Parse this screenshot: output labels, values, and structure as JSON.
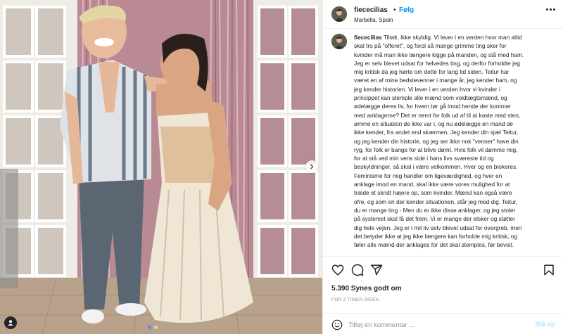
{
  "post": {
    "username": "fiececilias",
    "separator": "•",
    "follow_label": "Følg",
    "location": "Marbella, Spain",
    "caption_user": "fiececilias",
    "caption_text": "Tiltalt. Ikke skyldig. Vi lever i en verden hvor man altid\nskal tro på \"offeret\", og fordi så mange grimme ting sker for\nkvinder må man ikke længere kigge på manden, og stå med ham.\nJeg er selv blevet udsat for helvedes ting, og derfor forholdte jeg\nmig kritisk da jeg hørte om dette for lang tid siden. Teitur har\nværet en af mine bedstevenner i mange år, jeg kender ham, og\njeg kender historien. Vi lever i en verden hvor vi kvinder i\nprincippet kan stemple alle mænd som voldtægtsmænd, og\nødelægge deres liv, for hvem tør gå imod hende der kommer\nmed anklagerne? Det er nemt for folk ud af til at kaste med sten,\nømme en situation de ikke var i, og nu ødelægge en mand de\nikke kender, fra andet end skærmen. Jeg kender din sjæl Teitur,\nog jeg kender din historie, og jeg ser ikke nok \"venner\" have din\nryg, for folk er bange for at blive dømt. Hvis folk vil dømme mig,\nfor at stå ved min vens side i hans livs sværeste tid og\nbeskyldninger, så skal i være velkommen. Hver og en blokeres.\nFeminisme for mig handler om ligeværdighed, og hver en\nanklage imod en mand, skal ikke være vores mulighed for at\ntræde et skridt højere op, som kvinder. Mænd kan også være\nofre, og som en der kender situationen, står jeg med dig. Teitur,\ndu er mange ting - Men du er ikke disse anklager, og jeg stoler\npå systemet skal få det frem. Vi er mange der elsker og støtter\ndig hele vejen. Jeg er i mit liv selv blevet udsat for overgreb, men\ndet betyder ikke at jeg ikke længere kan forholde mig kritisk, og\nføler alle mænd der anklages for det skal stemples, før bevist.",
    "likes": "5.390 Synes godt om",
    "timestamp": "FOR 2 TIMER SIDEN",
    "comment_placeholder": "Tilføj en kommentar ...",
    "post_label": "Slå op"
  },
  "icons": {
    "like": "heart-icon",
    "comment": "comment-icon",
    "share": "paper-plane-icon",
    "save": "bookmark-icon",
    "emoji": "emoji-icon",
    "more": "more-options-icon",
    "next": "chevron-right-icon",
    "tag": "user-tag-icon"
  },
  "colors": {
    "accent": "#0095f6",
    "post_disabled": "#b2dffc",
    "text": "#262626",
    "muted": "#8e8e8e"
  }
}
